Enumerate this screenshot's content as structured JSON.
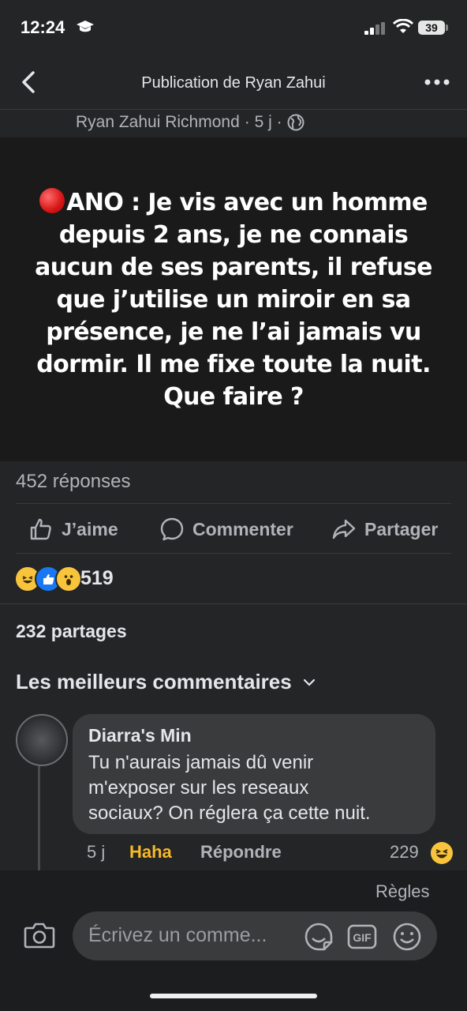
{
  "status_bar": {
    "time": "12:24",
    "battery": "39"
  },
  "nav": {
    "title": "Publication de Ryan Zahui"
  },
  "post": {
    "author": "Ryan Zahui Richmond",
    "meta": "· 5 j ·",
    "image_text": "ANO : Je vis avec un homme depuis 2 ans, je ne connais aucun de ses parents, il refuse que j’utilise un miroir en sa présence, je ne l’ai jamais vu dormir. Il me fixe toute la nuit. Que faire ?"
  },
  "stats": {
    "replies": "452 réponses",
    "reaction_count": "519",
    "shares": "232 partages"
  },
  "actions": {
    "like": "J’aime",
    "comment": "Commenter",
    "share": "Partager"
  },
  "comments_header": "Les meilleurs commentaires",
  "comment": {
    "author": "Diarra's Min",
    "text": "Tu n'aurais jamais dû venir\nm'exposer sur les reseaux\nsociaux? On réglera ça cette nuit.",
    "time": "5 j",
    "reaction_label": "Haha",
    "reply_label": "Répondre",
    "reaction_count": "229"
  },
  "footer": {
    "rules": "Règles",
    "input_placeholder": "Écrivez un comme..."
  },
  "colors": {
    "background": "#242526",
    "bubble": "#3a3b3c",
    "haha": "#f7b928",
    "like_blue": "#1877f2"
  }
}
